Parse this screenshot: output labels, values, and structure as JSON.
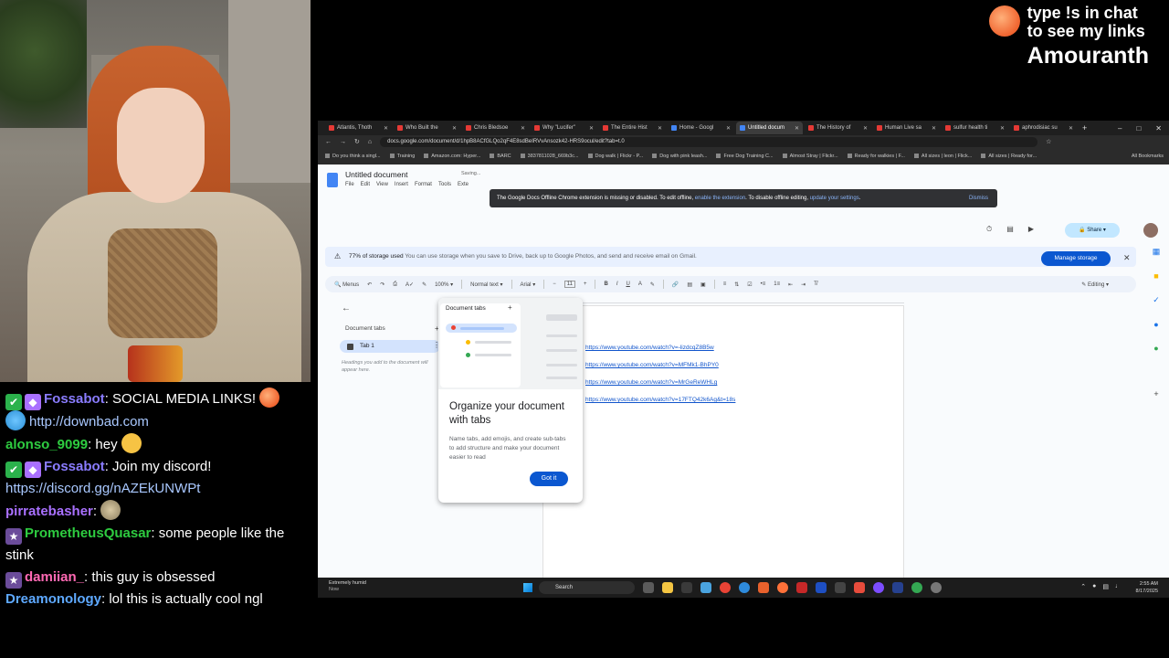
{
  "overlay": {
    "line1": "type !s in chat",
    "line2": "to see my links",
    "streamer": "Amouranth"
  },
  "chat": [
    {
      "badges": [
        "mod",
        "vip"
      ],
      "user": "Fossabot",
      "color": "#8a7cff",
      "text": ": SOCIAL MEDIA LINKS! ",
      "link": "http://downbad.com"
    },
    {
      "badges": [],
      "user": "alonso_9099",
      "color": "#2ecc40",
      "text": ": hey "
    },
    {
      "badges": [
        "mod",
        "vip"
      ],
      "user": "Fossabot",
      "color": "#8a7cff",
      "text": ": Join my discord!",
      "link": "https://discord.gg/nAZEkUNWPt"
    },
    {
      "badges": [],
      "user": "pirratebasher",
      "color": "#a970ff",
      "text": ": "
    },
    {
      "badges": [
        "sub"
      ],
      "user": "PrometheusQuasar",
      "color": "#2ecc40",
      "text": ": some people like the stink"
    },
    {
      "badges": [
        "sub"
      ],
      "user": "damiian_",
      "color": "#ff69b4",
      "text": ": this guy is obsessed"
    },
    {
      "badges": [],
      "user": "Dreamonology",
      "color": "#5ea9ff",
      "text": ": lol this is actually cool ngl"
    }
  ],
  "browser": {
    "tabs": [
      "Atlantis, Thoth",
      "Who Built the",
      "Chris Bledsoe",
      "Why \"Lucifer\"",
      "The Entire Hist",
      "Home - Googl",
      "Untitled docum",
      "The History of",
      "Human Live sa",
      "sulfur health ti",
      "aphrodisiac su"
    ],
    "active_tab": 6,
    "url": "docs.google.com/document/d/1hpB8ACfGLQo2qF4E8sdBeIRVvAnsozk42-HRS9ocul/edit?tab=t.0",
    "bookmarks": [
      "Do you think a singl...",
      "Training",
      "Amazon.com: Hyper...",
      "BARC",
      "3837811028_669b3c...",
      "Dog walk | Flickr - P...",
      "Dog with pink leash...",
      "Free Dog Training C...",
      "Almost Stray | Flickr...",
      "Ready for walkies | F...",
      "All sizes | leon | Flick...",
      "All sizes | Ready for..."
    ],
    "all_bookmarks": "All Bookmarks"
  },
  "docs": {
    "title": "Untitled document",
    "saving": "Saving...",
    "menus": [
      "File",
      "Edit",
      "View",
      "Insert",
      "Format",
      "Tools",
      "Exte"
    ],
    "offline_banner": {
      "text": "The Google Docs Offline Chrome extension is missing or disabled. To edit offline, ",
      "link1": "enable the extension",
      "mid": ". To disable offline editing, ",
      "link2": "update your settings",
      "end": ".",
      "dismiss": "Dismiss"
    },
    "share": "Share",
    "storage": {
      "bold": "77% of storage used",
      "rest": " You can use storage when you save to Drive, back up to Google Photos, and send and receive email on Gmail.",
      "button": "Manage storage"
    },
    "toolbar": {
      "menus": "Menus",
      "zoom": "100%",
      "style": "Normal text",
      "font": "Arial",
      "size": "11",
      "mode": "Editing"
    },
    "side": {
      "heading": "Document tabs",
      "tab": "Tab 1",
      "hint": "Headings you add to the document will appear here."
    },
    "popup": {
      "art_title": "Document tabs",
      "title": "Organize your document with tabs",
      "body": "Name tabs, add emojis, and create sub-tabs to add structure and make your document easier to read",
      "button": "Got it"
    },
    "links": [
      "https://www.youtube.com/watch?v=-lizdcqZ8B5w",
      "https://www.youtube.com/watch?v=MFMk1-BhPY0",
      "https://www.youtube.com/watch?v=MrGeReWHLg",
      "https://www.youtube.com/watch?v=17FTQ42k6Ag&t=18s"
    ]
  },
  "taskbar": {
    "weather_title": "Extremely humid",
    "weather_sub": "Now",
    "search": "Search",
    "time": "2:55 AM",
    "date": "8/17/2025"
  }
}
